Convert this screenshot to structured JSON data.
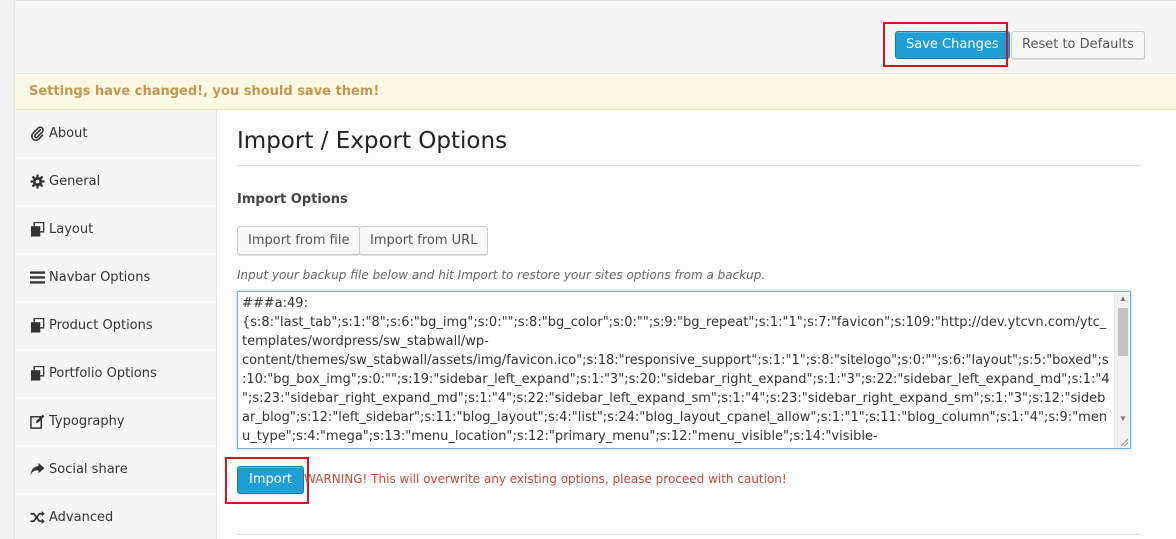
{
  "toolbar": {
    "save_label": "Save Changes",
    "reset_label": "Reset to Defaults"
  },
  "notice": {
    "text": "Settings have changed!, you should save them!"
  },
  "sidebar": {
    "items": [
      {
        "label": "About",
        "icon": "paperclip-icon"
      },
      {
        "label": "General",
        "icon": "gear-icon"
      },
      {
        "label": "Layout",
        "icon": "copy-icon"
      },
      {
        "label": "Navbar Options",
        "icon": "bars-icon"
      },
      {
        "label": "Product Options",
        "icon": "copy-icon"
      },
      {
        "label": "Portfolio Options",
        "icon": "copy-icon"
      },
      {
        "label": "Typography",
        "icon": "edit-icon"
      },
      {
        "label": "Social share",
        "icon": "share-icon"
      },
      {
        "label": "Advanced",
        "icon": "shuffle-icon"
      }
    ]
  },
  "main": {
    "title": "Import / Export Options",
    "section_label": "Import Options",
    "import_file_label": "Import from file",
    "import_url_label": "Import from URL",
    "hint": "Input your backup file below and hit Import to restore your sites options from a backup.",
    "textarea_value": "###a:49:\n{s:8:\"last_tab\";s:1:\"8\";s:6:\"bg_img\";s:0:\"\";s:8:\"bg_color\";s:0:\"\";s:9:\"bg_repeat\";s:1:\"1\";s:7:\"favicon\";s:109:\"http://dev.ytcvn.com/ytc_templates/wordpress/sw_stabwall/wp-content/themes/sw_stabwall/assets/img/favicon.ico\";s:18:\"responsive_support\";s:1:\"1\";s:8:\"sitelogo\";s:0:\"\";s:6:\"layout\";s:5:\"boxed\";s:10:\"bg_box_img\";s:0:\"\";s:19:\"sidebar_left_expand\";s:1:\"3\";s:20:\"sidebar_right_expand\";s:1:\"3\";s:22:\"sidebar_left_expand_md\";s:1:\"4\";s:23:\"sidebar_right_expand_md\";s:1:\"4\";s:22:\"sidebar_left_expand_sm\";s:1:\"4\";s:23:\"sidebar_right_expand_sm\";s:1:\"3\";s:12:\"sidebar_blog\";s:12:\"left_sidebar\";s:11:\"blog_layout\";s:4:\"list\";s:24:\"blog_layout_cpanel_allow\";s:1:\"1\";s:11:\"blog_column\";s:1:\"4\";s:9:\"menu_type\";s:4:\"mega\";s:13:\"menu_location\";s:12:\"primary_menu\";s:12:\"menu_visible\";s:14:\"visible-",
    "import_button_label": "Import",
    "warning": "WARNING! This will overwrite any existing options, please proceed with caution!"
  },
  "colors": {
    "primary": "#1e9fd6",
    "highlight": "#d3161b",
    "notice_bg": "#fcf8e3",
    "notice_text": "#c09853",
    "warning_text": "#c44d3a"
  }
}
